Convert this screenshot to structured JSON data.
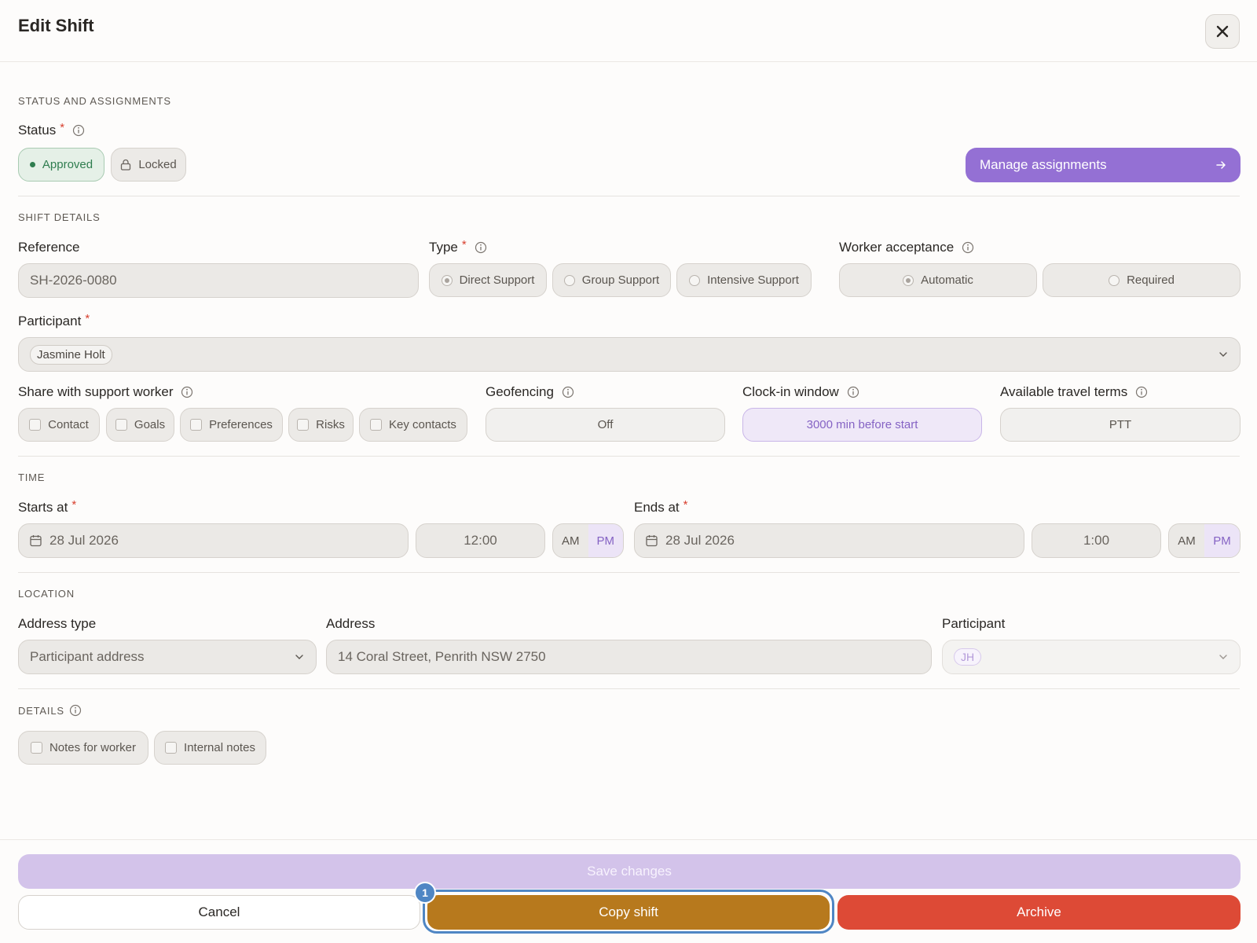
{
  "header": {
    "title": "Edit Shift",
    "close_icon": "close-icon"
  },
  "status_section": {
    "heading": "STATUS AND ASSIGNMENTS",
    "status_label": "Status",
    "required_mark": "*",
    "approved_label": "Approved",
    "locked_label": "Locked",
    "manage_label": "Manage assignments"
  },
  "details_section": {
    "heading": "SHIFT DETAILS",
    "reference_label": "Reference",
    "reference_value": "SH-2026-0080",
    "type_label": "Type",
    "type_options": [
      "Direct Support",
      "Group Support",
      "Intensive Support"
    ],
    "type_selected": "Direct Support",
    "acceptance_label": "Worker acceptance",
    "acceptance_options": [
      "Automatic",
      "Required"
    ],
    "acceptance_selected": "Automatic",
    "participant_label": "Participant",
    "participant_value": "Jasmine Holt",
    "share_label": "Share with support worker",
    "share_options": [
      "Contact",
      "Goals",
      "Preferences",
      "Risks",
      "Key contacts"
    ],
    "geofencing_label": "Geofencing",
    "geofencing_value": "Off",
    "clockin_label": "Clock-in window",
    "clockin_value": "3000 min before start",
    "travel_label": "Available travel terms",
    "travel_value": "PTT"
  },
  "time_section": {
    "heading": "TIME",
    "starts_label": "Starts at",
    "start_date": "28 Jul 2026",
    "start_time": "12:00",
    "ends_label": "Ends at",
    "end_date": "28 Jul 2026",
    "end_time": "1:00",
    "am": "AM",
    "pm": "PM"
  },
  "location_section": {
    "heading": "LOCATION",
    "address_type_label": "Address type",
    "address_type_value": "Participant address",
    "address_label": "Address",
    "address_value": "14 Coral Street, Penrith NSW 2750",
    "participant_label": "Participant",
    "participant_initials": "JH"
  },
  "notes_section": {
    "heading": "DETAILS",
    "notes_for_worker": "Notes for worker",
    "internal_notes": "Internal notes"
  },
  "footer": {
    "save_label": "Save changes",
    "cancel_label": "Cancel",
    "copy_label": "Copy shift",
    "archive_label": "Archive",
    "step_badge": "1"
  },
  "colors": {
    "accent_purple": "#9470d4",
    "save_disabled": "#d3c3ea",
    "copy_gold": "#b7791d",
    "archive_red": "#dd4a36",
    "approved_green": "#2f7d4f",
    "badge_blue": "#4f86c4"
  }
}
